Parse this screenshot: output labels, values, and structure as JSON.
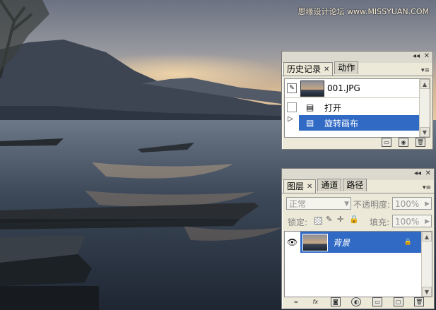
{
  "watermark": "思缘设计论坛 www.MISSYUAN.COM",
  "history_panel": {
    "tabs": [
      {
        "label": "历史记录",
        "active": true
      },
      {
        "label": "动作",
        "active": false
      }
    ],
    "snapshot_name": "001.JPG",
    "items": [
      {
        "label": "打开",
        "selected": false
      },
      {
        "label": "旋转画布",
        "selected": true
      }
    ]
  },
  "layers_panel": {
    "tabs": [
      {
        "label": "图层",
        "active": true
      },
      {
        "label": "通道",
        "active": false
      },
      {
        "label": "路径",
        "active": false
      }
    ],
    "blend_mode": "正常",
    "opacity_label": "不透明度:",
    "opacity_value": "100%",
    "lock_label": "锁定:",
    "fill_label": "填充:",
    "fill_value": "100%",
    "layers": [
      {
        "name": "背景",
        "selected": true,
        "visible": true,
        "locked": true
      }
    ]
  },
  "icons": {
    "close": "close-icon",
    "eye": "eye-icon",
    "lock": "lock-icon",
    "brush": "brush-icon",
    "trash": "trash-icon"
  },
  "colors": {
    "selection": "#316ac5",
    "panel_bg": "#ece9d8"
  }
}
